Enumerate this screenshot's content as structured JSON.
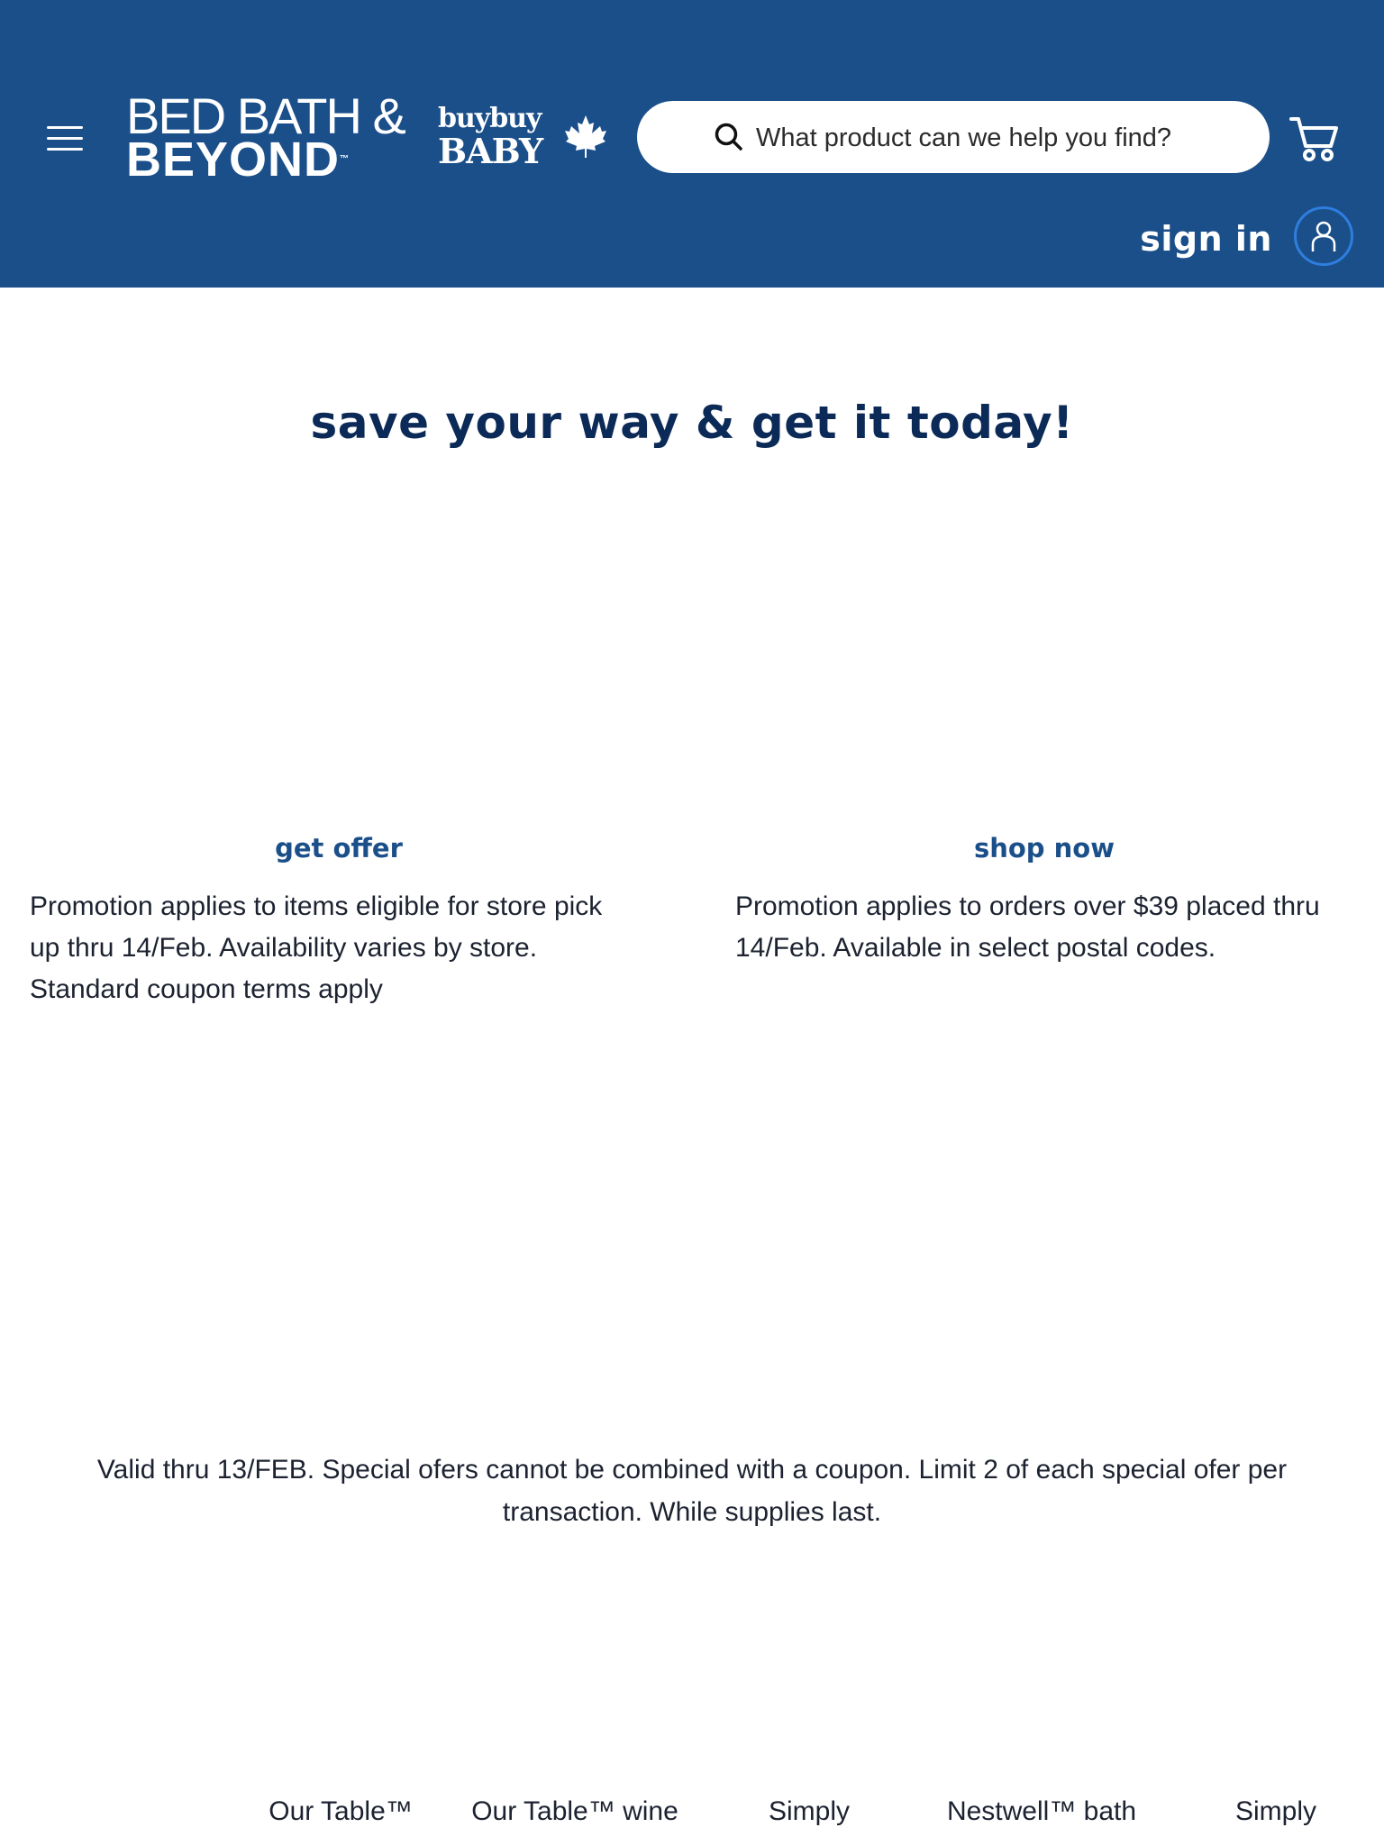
{
  "header": {
    "brand": {
      "line1": "BED BATH &",
      "line2": "BEYOND",
      "tm": "™",
      "sub_line1": "buybuy",
      "sub_line2": "BABY"
    },
    "search": {
      "placeholder": "What product can we help you find?"
    },
    "sign_in": "sign in",
    "colors": {
      "header_bg": "#1b4f8a",
      "account_ring": "#2e7ee0"
    },
    "icons": [
      "hamburger-menu-icon",
      "search-icon",
      "cart-icon",
      "maple-leaf-icon",
      "user-icon"
    ]
  },
  "main": {
    "headline": "save your way & get it today!",
    "promos": [
      {
        "cta": "get offer",
        "lines": [
          "Promotion applies to items eligible for store pick",
          "up thru 14/Feb. Availability varies by store.",
          "Standard coupon terms apply"
        ]
      },
      {
        "cta": "shop now",
        "lines": [
          "Promotion applies to orders over $39 placed thru",
          "14/Feb. Available in select postal codes."
        ]
      }
    ],
    "disclaimer": {
      "line1": "Valid thru 13/FEB. Special ofers cannot be combined with a coupon. Limit 2 of each special ofer per",
      "line2": "transaction. While supplies last."
    },
    "products": [
      "Our Table™",
      "Our Table™ wine",
      "Simply",
      "Nestwell™ bath",
      "Simply"
    ],
    "colors": {
      "headline": "#0b2a57",
      "cta": "#1b4f8a"
    }
  }
}
